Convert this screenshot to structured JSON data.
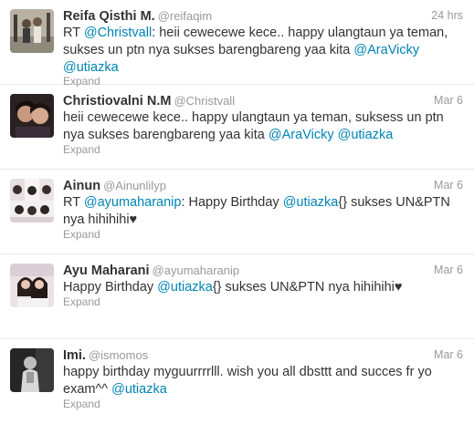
{
  "tweets": [
    {
      "fullname": "Reifa Qisthi M.",
      "username": "@reifaqim",
      "time": "24 hrs",
      "parts": [
        {
          "t": "RT "
        },
        {
          "t": "@Christvall",
          "link": true
        },
        {
          "t": ": heii cewecewe kece.. happy ulangtaun ya teman, sukses un ptn nya sukses barengbareng yaa kita "
        },
        {
          "t": "@AraVicky",
          "link": true
        },
        {
          "t": " "
        },
        {
          "t": "@utiazka",
          "link": true
        }
      ],
      "expand": "Expand"
    },
    {
      "fullname": "Christiovalni N.M",
      "username": "@Christvall",
      "time": "Mar 6",
      "parts": [
        {
          "t": "heii cewecewe kece.. happy ulangtaun ya teman, suksess un ptn nya sukses barengbareng yaa kita "
        },
        {
          "t": "@AraVicky",
          "link": true
        },
        {
          "t": " "
        },
        {
          "t": "@utiazka",
          "link": true
        }
      ],
      "expand": "Expand"
    },
    {
      "fullname": "Ainun",
      "username": "@Ainunlilyp",
      "time": "Mar 6",
      "parts": [
        {
          "t": "RT "
        },
        {
          "t": "@ayumaharanip",
          "link": true
        },
        {
          "t": ": Happy Birthday "
        },
        {
          "t": "@utiazka",
          "link": true
        },
        {
          "t": "{} sukses UN&PTN nya hihihihi♥"
        }
      ],
      "expand": "Expand"
    },
    {
      "fullname": "Ayu Maharani",
      "username": "@ayumaharanip",
      "time": "Mar 6",
      "parts": [
        {
          "t": "Happy Birthday "
        },
        {
          "t": "@utiazka",
          "link": true
        },
        {
          "t": "{} sukses UN&PTN nya hihihihi♥"
        }
      ],
      "expand": "Expand"
    },
    {
      "fullname": "Imi.",
      "username": "@ismomos",
      "time": "Mar 6",
      "parts": [
        {
          "t": "happy birthday myguurrrrlll. wish you all dbsttt and succes fr yo exam^^ "
        },
        {
          "t": "@utiazka",
          "link": true
        }
      ],
      "expand": "Expand"
    }
  ]
}
